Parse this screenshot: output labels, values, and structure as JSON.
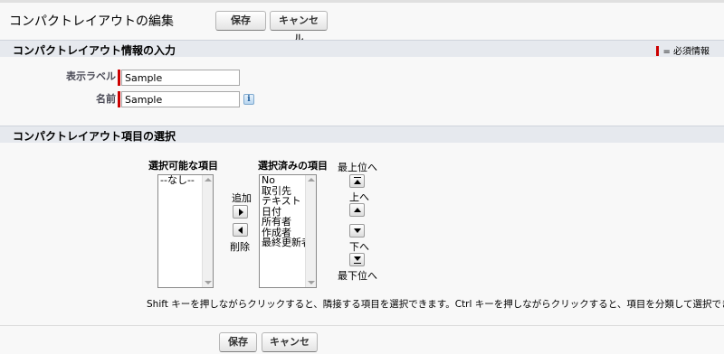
{
  "header": {
    "title": "コンパクトレイアウトの編集",
    "save_label": "保存",
    "cancel_label": "キャンセル"
  },
  "info_section": {
    "title": "コンパクトレイアウト情報の入力",
    "required_legend": "= 必須情報",
    "display_label": {
      "label": "表示ラベル",
      "value": "Sample"
    },
    "api_name": {
      "label": "名前",
      "value": "Sample"
    },
    "info_icon_text": "i"
  },
  "fields_section": {
    "title": "コンパクトレイアウト項目の選択",
    "available": {
      "heading": "選択可能な項目",
      "options": [
        "--なし--"
      ]
    },
    "selected": {
      "heading": "選択済みの項目",
      "options": [
        "No",
        "取引先",
        "テキスト",
        "日付",
        "所有者",
        "作成者",
        "最終更新者"
      ]
    },
    "add_label": "追加",
    "remove_label": "削除",
    "top_label": "最上位へ",
    "up_label": "上へ",
    "down_label": "下へ",
    "bottom_label": "最下位へ",
    "help_text": "Shift キーを押しながらクリックすると、隣接する項目を選択できます。Ctrl キーを押しながらクリックすると、項目を分類して選択できます。"
  },
  "footer": {
    "save_label": "保存",
    "cancel_label": "キャンセル"
  },
  "colors": {
    "required": "#cc0000",
    "section_bar": "#e6e9ee",
    "background": "#f8f8f8"
  }
}
